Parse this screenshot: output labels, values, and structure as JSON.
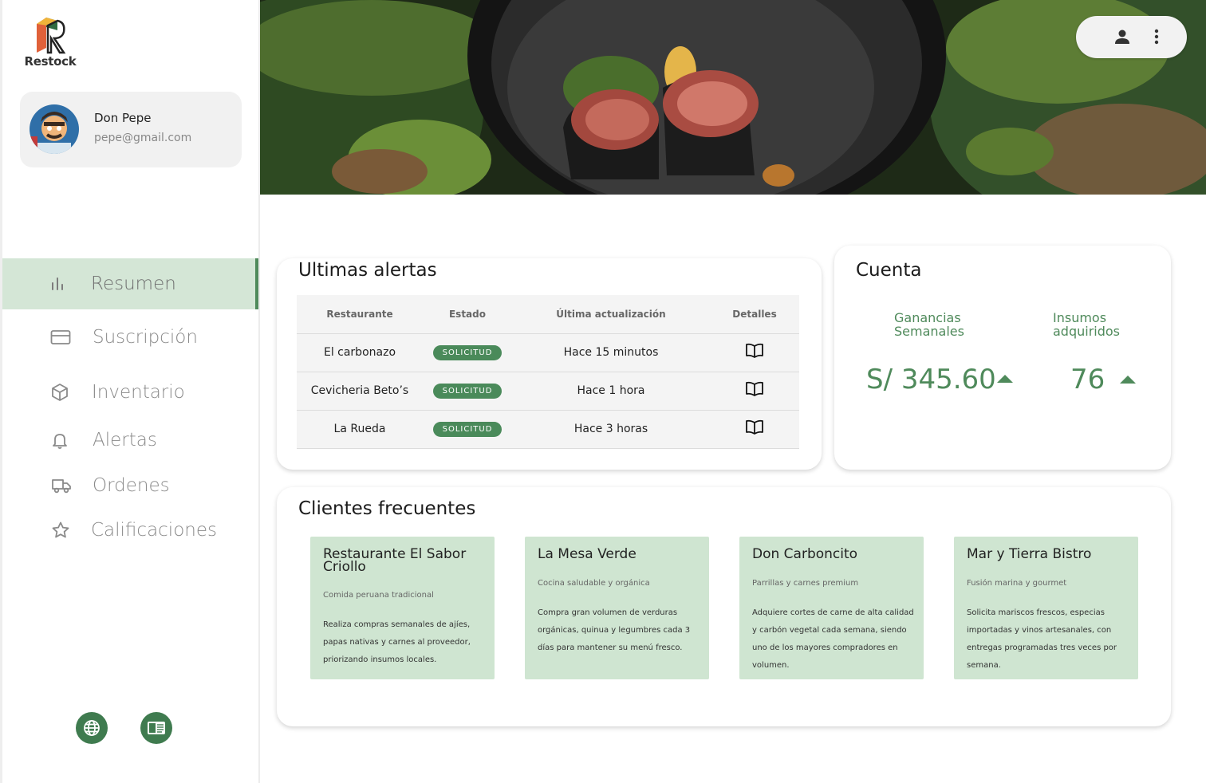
{
  "app": {
    "logo_text": "Restock"
  },
  "profile": {
    "name": "Don Pepe",
    "email": "pepe@gmail.com"
  },
  "sidebar": {
    "items": [
      {
        "label": "Resumen",
        "icon": "bar-chart-icon",
        "active": true
      },
      {
        "label": "Suscripción",
        "icon": "credit-card-icon"
      },
      {
        "label": "Inventario",
        "icon": "box-icon"
      },
      {
        "label": "Alertas",
        "icon": "bell-icon"
      },
      {
        "label": "Ordenes",
        "icon": "truck-icon"
      },
      {
        "label": "Calificaciones",
        "icon": "star-icon"
      }
    ],
    "bottom_buttons": [
      "globe-icon",
      "book-open-icon"
    ]
  },
  "topbar": {
    "buttons": [
      "user-icon",
      "more-vertical-icon"
    ]
  },
  "alerts": {
    "title": "Ultimas alertas",
    "columns": [
      "Restaurante",
      "Estado",
      "Última actualización",
      "Detalles"
    ],
    "rows": [
      {
        "restaurant": "El carbonazo",
        "status": "SOLICITUD",
        "updated": "Hace 15 minutos"
      },
      {
        "restaurant": "Cevicheria Beto’s",
        "status": "SOLICITUD",
        "updated": "Hace 1 hora"
      },
      {
        "restaurant": "La Rueda",
        "status": "SOLICITUD",
        "updated": "Hace 3 horas"
      }
    ]
  },
  "account": {
    "title": "Cuenta",
    "earnings_label_1": "Ganancias",
    "earnings_label_2": "Semanales",
    "earnings_value": "S/ 345.60",
    "supplies_label_1": "Insumos",
    "supplies_label_2": "adquiridos",
    "supplies_value": "76"
  },
  "clients": {
    "title": "Clientes frecuentes",
    "items": [
      {
        "name": "Restaurante El Sabor Criollo",
        "subtitle": "Comida peruana tradicional",
        "description": "Realiza compras semanales de ajíes, papas nativas y carnes al proveedor, priorizando insumos locales."
      },
      {
        "name": "La Mesa Verde",
        "subtitle": "Cocina saludable y orgánica",
        "description": "Compra gran volumen de verduras orgánicas, quinua y legumbres cada 3 días para mantener su menú fresco."
      },
      {
        "name": "Don Carboncito",
        "subtitle": "Parrillas y carnes premium",
        "description": "Adquiere cortes de carne de alta calidad y carbón vegetal cada semana, siendo uno de los mayores compradores en volumen."
      },
      {
        "name": "Mar y Tierra Bistro",
        "subtitle": "Fusión marina y gourmet",
        "description": "Solicita mariscos frescos, especias importadas y vinos artesanales, con entregas programadas tres veces por semana."
      }
    ]
  },
  "colors": {
    "accent": "#4f8a5b",
    "accent_light": "#d4e6d6",
    "card_green": "#cfe5d1",
    "badge": "#4a8a5a"
  }
}
